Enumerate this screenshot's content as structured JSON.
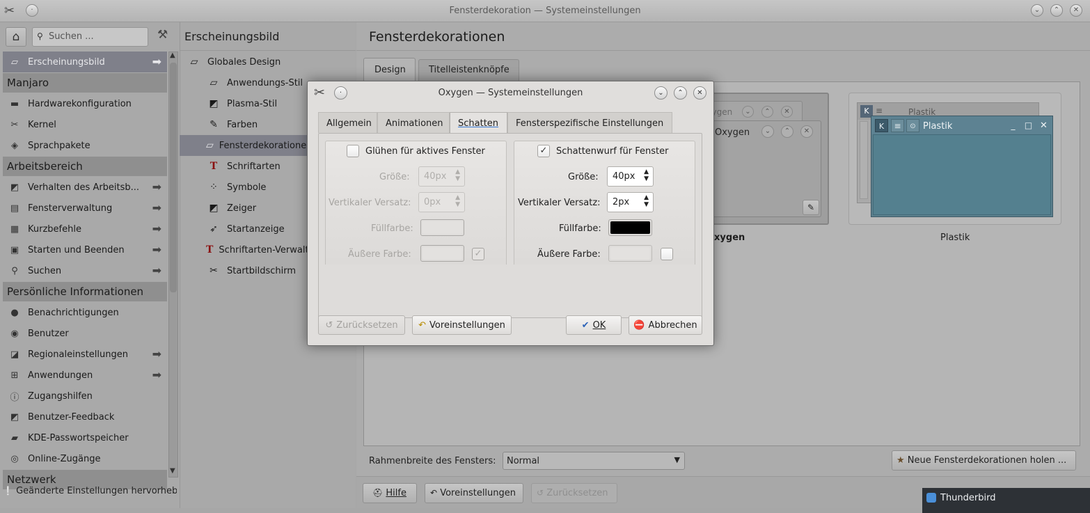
{
  "window": {
    "title": "Fensterdekoration — Systemeinstellungen"
  },
  "search": {
    "placeholder": "Suchen ..."
  },
  "left_nav": {
    "header": "Erscheinungsbild",
    "items": [
      {
        "label": "Erscheinungsbild",
        "type": "item",
        "selected": true,
        "arrow": true,
        "icon": "appearance-icon"
      },
      {
        "label": "Manjaro",
        "type": "category"
      },
      {
        "label": "Hardwarekonfiguration",
        "type": "item",
        "icon": "hardware-icon"
      },
      {
        "label": "Kernel",
        "type": "item",
        "icon": "kernel-icon"
      },
      {
        "label": "Sprachpakete",
        "type": "item",
        "icon": "language-icon"
      },
      {
        "label": "Arbeitsbereich",
        "type": "category"
      },
      {
        "label": "Verhalten des Arbeitsb...",
        "type": "item",
        "arrow": true,
        "icon": "desktop-behavior-icon"
      },
      {
        "label": "Fensterverwaltung",
        "type": "item",
        "arrow": true,
        "icon": "window-management-icon"
      },
      {
        "label": "Kurzbefehle",
        "type": "item",
        "arrow": true,
        "icon": "shortcuts-icon"
      },
      {
        "label": "Starten und Beenden",
        "type": "item",
        "arrow": true,
        "icon": "startup-icon"
      },
      {
        "label": "Suchen",
        "type": "item",
        "arrow": true,
        "icon": "search-icon"
      },
      {
        "label": "Persönliche Informationen",
        "type": "category"
      },
      {
        "label": "Benachrichtigungen",
        "type": "item",
        "icon": "notifications-icon"
      },
      {
        "label": "Benutzer",
        "type": "item",
        "icon": "user-icon"
      },
      {
        "label": "Regionaleinstellungen",
        "type": "item",
        "arrow": true,
        "icon": "regional-icon"
      },
      {
        "label": "Anwendungen",
        "type": "item",
        "arrow": true,
        "icon": "applications-icon"
      },
      {
        "label": "Zugangshilfen",
        "type": "item",
        "icon": "accessibility-icon"
      },
      {
        "label": "Benutzer-Feedback",
        "type": "item",
        "icon": "feedback-icon"
      },
      {
        "label": "KDE-Passwortspeicher",
        "type": "item",
        "icon": "wallet-icon"
      },
      {
        "label": "Online-Zugänge",
        "type": "item",
        "icon": "online-accounts-icon"
      },
      {
        "label": "Netzwerk",
        "type": "category"
      }
    ],
    "footer": "Geänderte Einstellungen hervorheb"
  },
  "middle_nav": {
    "items": [
      {
        "label": "Globales Design",
        "icon": "global-theme-icon",
        "indent": false
      },
      {
        "label": "Anwendungs-Stil",
        "icon": "app-style-icon",
        "indent": true
      },
      {
        "label": "Plasma-Stil",
        "icon": "plasma-style-icon",
        "indent": true
      },
      {
        "label": "Farben",
        "icon": "colors-icon",
        "indent": true
      },
      {
        "label": "Fensterdekorationen",
        "icon": "window-decoration-icon",
        "indent": true,
        "selected": true
      },
      {
        "label": "Schriftarten",
        "icon": "fonts-icon",
        "indent": true
      },
      {
        "label": "Symbole",
        "icon": "icons-icon",
        "indent": true
      },
      {
        "label": "Zeiger",
        "icon": "cursor-icon",
        "indent": true
      },
      {
        "label": "Startanzeige",
        "icon": "launch-feedback-icon",
        "indent": true
      },
      {
        "label": "Schriftarten-Verwaltung",
        "icon": "font-management-icon",
        "indent": true
      },
      {
        "label": "Startbildschirm",
        "icon": "splash-icon",
        "indent": true
      }
    ]
  },
  "main": {
    "title": "Fensterdekorationen",
    "tabs": [
      "Design",
      "Titelleistenknöpfe"
    ],
    "preview_titles": {
      "oxygen_back": "Oxygen",
      "oxygen_front": "Oxygen",
      "plastik_back": "Plastik",
      "plastik_front": "Plastik"
    },
    "themes": [
      "Oxygen",
      "Plastik"
    ],
    "border_label": "Rahmenbreite des Fensters:",
    "border_value": "Normal",
    "get_new_label": "Neue Fensterdekorationen holen ...",
    "bottom_buttons": {
      "help": "Hilfe",
      "defaults": "Voreinstellungen",
      "reset": "Zurücksetzen"
    }
  },
  "dialog": {
    "title": "Oxygen — Systemeinstellungen",
    "tabs": [
      "Allgemein",
      "Animationen",
      "Schatten",
      "Fensterspezifische Einstellungen"
    ],
    "active_tab": "Schatten",
    "left_group": {
      "checkbox_label": "Glühen für aktives Fenster",
      "checked": false,
      "size_label": "Größe:",
      "size_value": "40px",
      "offset_label": "Vertikaler Versatz:",
      "offset_value": "0px",
      "fill_label": "Füllfarbe:",
      "fill_color": "#e3e1df",
      "outer_label": "Äußere Farbe:",
      "outer_color": "#e3e1df",
      "outer_checked": true
    },
    "right_group": {
      "checkbox_label": "Schattenwurf für Fenster",
      "checked": true,
      "size_label": "Größe:",
      "size_value": "40px",
      "offset_label": "Vertikaler Versatz:",
      "offset_value": "2px",
      "fill_label": "Füllfarbe:",
      "fill_color": "#000000",
      "outer_label": "Äußere Farbe:",
      "outer_color": "#e3e1df",
      "outer_checked": false
    },
    "buttons": {
      "reset": "Zurücksetzen",
      "defaults": "Voreinstellungen",
      "ok": "OK",
      "cancel": "Abbrechen"
    }
  },
  "notification": {
    "app": "Thunderbird"
  }
}
